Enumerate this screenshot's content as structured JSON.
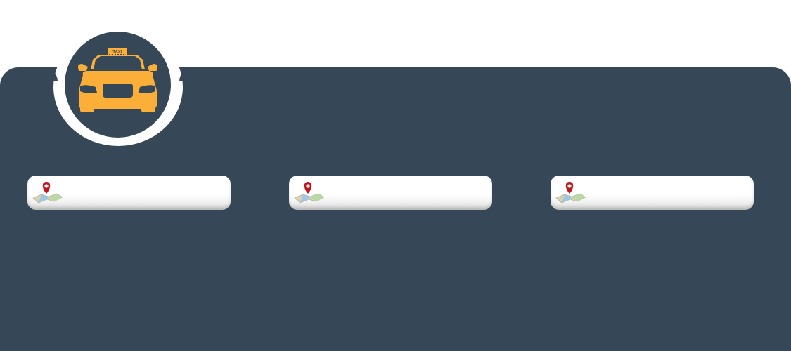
{
  "logo": {
    "icon": "taxi-icon",
    "sign_text": "TAXI",
    "car_color": "#FCAF38",
    "badge_color": "#364857"
  },
  "theme": {
    "panel_color": "#364857",
    "background": "#FFFFFF"
  },
  "fields": [
    {
      "icon": "map-pin-icon",
      "value": "",
      "placeholder": ""
    },
    {
      "icon": "map-pin-icon",
      "value": "",
      "placeholder": ""
    },
    {
      "icon": "map-pin-icon",
      "value": "",
      "placeholder": ""
    }
  ]
}
